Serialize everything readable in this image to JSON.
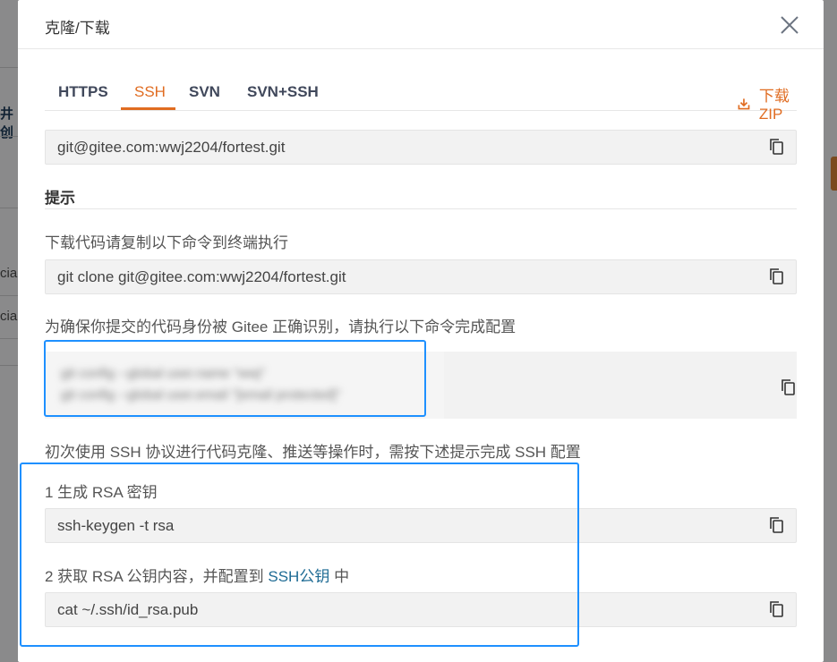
{
  "modal": {
    "title": "克隆/下载"
  },
  "tabs": [
    {
      "label": "HTTPS",
      "active": false
    },
    {
      "label": "SSH",
      "active": true
    },
    {
      "label": "SVN",
      "active": false
    },
    {
      "label": "SVN+SSH",
      "active": false
    }
  ],
  "download_zip_label": "下载ZIP",
  "clone_url": "git@gitee.com:wwj2204/fortest.git",
  "tips": {
    "title": "提示",
    "step_download": "下载代码请复制以下命令到终端执行",
    "clone_command": "git clone git@gitee.com:wwj2204/fortest.git",
    "config_intro": "为确保你提交的代码身份被 Gitee 正确识别，请执行以下命令完成配置",
    "config_commands": [
      "git config --global user.name \"wwj\"",
      "git config --global user.email \"[email protected]\""
    ],
    "ssh_intro": "初次使用 SSH 协议进行代码克隆、推送等操作时，需按下述提示完成 SSH 配置",
    "step1_label": "1 生成 RSA 密钥",
    "step1_command": "ssh-keygen -t rsa",
    "step2_label_prefix": "2 获取 RSA 公钥内容，并配置到 ",
    "step2_link": "SSH公钥",
    "step2_label_suffix": " 中",
    "step2_command": "cat ~/.ssh/id_rsa.pub"
  },
  "background": {
    "fragment1": "井创",
    "fragment2": "cial",
    "fragment3": "cial"
  },
  "colors": {
    "accent": "#e06c21",
    "link": "#1e6b94",
    "highlight": "#1e90ff"
  }
}
